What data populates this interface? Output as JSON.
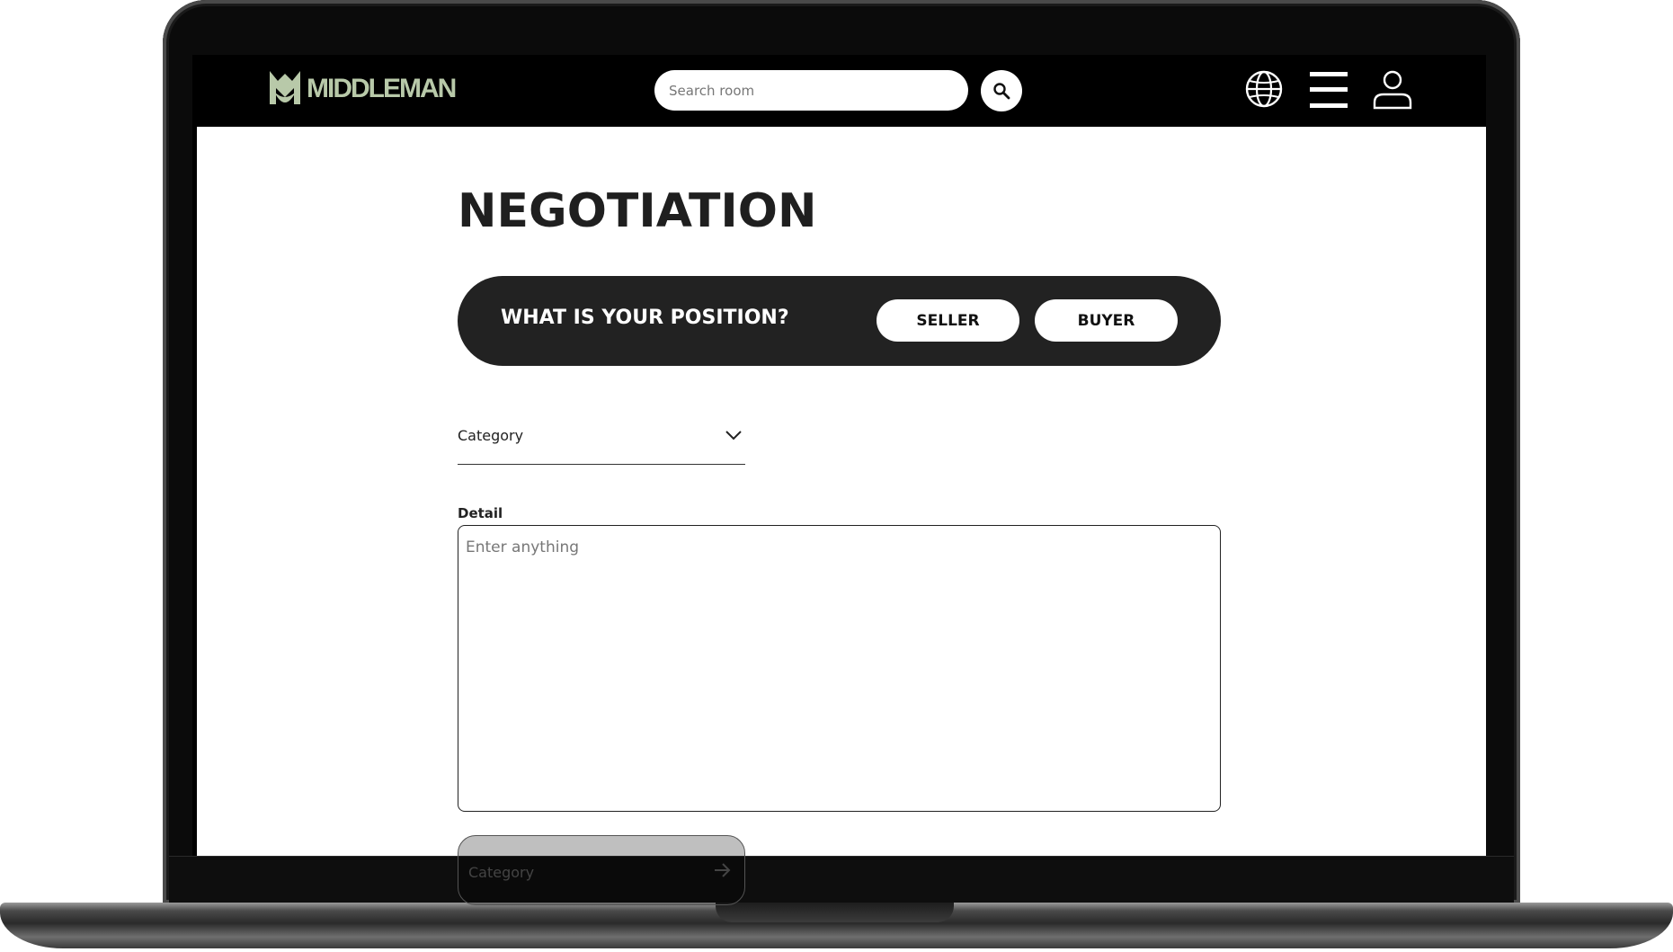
{
  "navbar": {
    "brand": "MIDDLEMAN",
    "search": {
      "placeholder": "Search room",
      "value": ""
    },
    "icons": [
      "logo-icon",
      "search-icon",
      "globe-icon",
      "menu-icon",
      "user-icon"
    ]
  },
  "page": {
    "title": "NEGOTIATION",
    "position": {
      "question": "WHAT IS YOUR POSITION?",
      "options": [
        "SELLER",
        "BUYER"
      ]
    },
    "category": {
      "label": "Category"
    },
    "detail": {
      "label": "Detail",
      "placeholder": "Enter anything",
      "value": ""
    },
    "category_button": {
      "label": "Category"
    }
  },
  "colors": {
    "brand": "#b8c9a9",
    "navbar_bg": "#000000",
    "position_bar_bg": "#222222",
    "text_dark": "#1f1f1f"
  }
}
